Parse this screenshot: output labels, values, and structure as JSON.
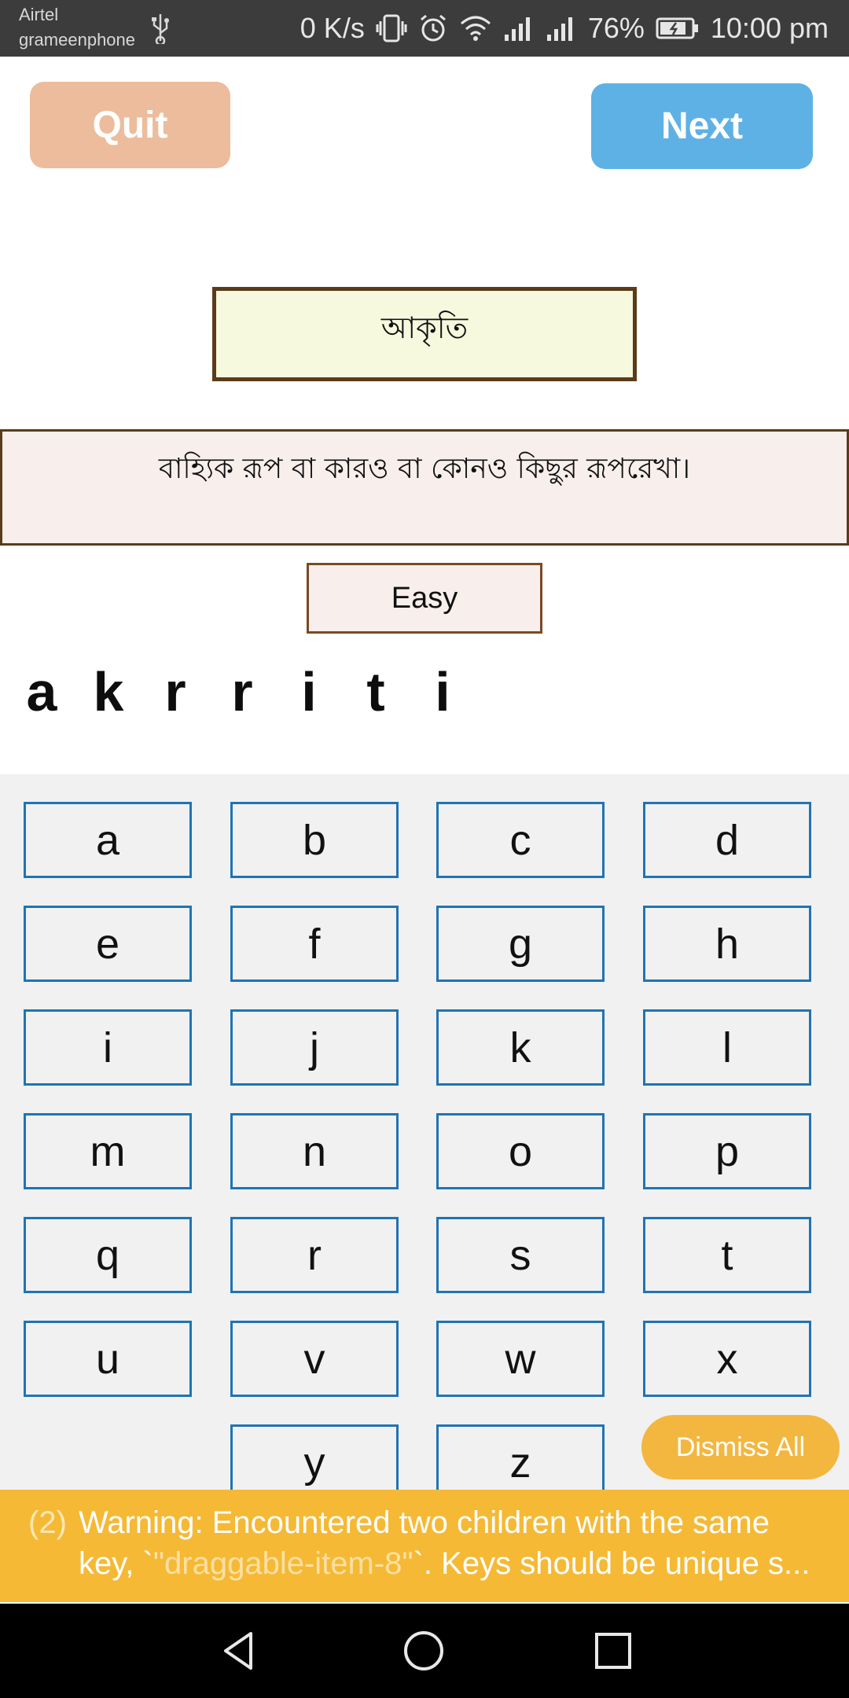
{
  "status_bar": {
    "carrier_line1": "Airtel",
    "carrier_line2": "grameenphone",
    "speed": "0 K/s",
    "battery": "76%",
    "time": "10:00 pm",
    "icons": [
      "usb-icon",
      "vibrate-icon",
      "alarm-icon",
      "wifi-icon",
      "signal-icon",
      "signal-icon",
      "battery-icon"
    ]
  },
  "header": {
    "quit_label": "Quit",
    "next_label": "Next"
  },
  "word": "আকৃতি",
  "meaning": "বাহ্যিক রূপ বা কারও বা কোনও কিছুর রূপরেখা।",
  "difficulty": "Easy",
  "answer_letters": [
    "a",
    "k",
    "r",
    "r",
    "i",
    "t",
    "i"
  ],
  "keyboard": {
    "keys": [
      "a",
      "b",
      "c",
      "d",
      "e",
      "f",
      "g",
      "h",
      "i",
      "j",
      "k",
      "l",
      "m",
      "n",
      "o",
      "p",
      "q",
      "r",
      "s",
      "t",
      "u",
      "v",
      "w",
      "x",
      "y",
      "z"
    ]
  },
  "dismiss_label": "Dismiss All",
  "warning": {
    "count": "(2)",
    "line1": "Warning: Encountered two children with the same",
    "line2_prefix": "key, `",
    "line2_key": "\"draggable-item-8\"",
    "line2_suffix": "`. Keys should be unique s..."
  },
  "colors": {
    "quit": "#ecbc9c",
    "next": "#5eb1e4",
    "key_border": "#1f74b4",
    "warning_bg": "#f5b935",
    "word_box_bg": "#f6f9de",
    "word_box_border": "#5a3b1a"
  }
}
